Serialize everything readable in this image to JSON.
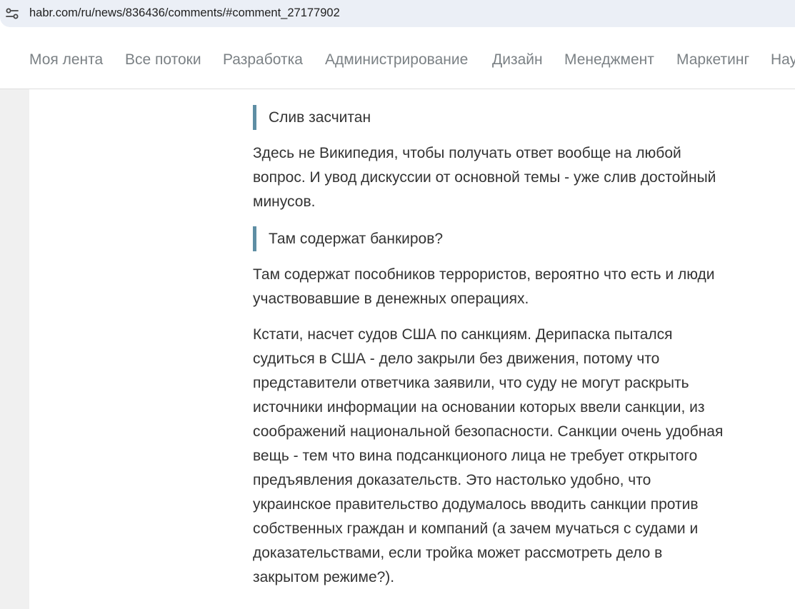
{
  "browser": {
    "url": "habr.com/ru/news/836436/comments/#comment_27177902",
    "site_info_icon": "tune-icon"
  },
  "nav": {
    "items": [
      "Моя лента",
      "Все потоки",
      "Разработка",
      "Администрирование",
      "Дизайн",
      "Менеджмент",
      "Маркетинг",
      "Нау"
    ]
  },
  "comment": {
    "quote1": "Слив засчитан",
    "para1": [
      "Здесь не Википедия, чтобы получать ответ вообще на любой",
      "вопрос. И увод дискуссии от основной темы - уже слив достойный",
      "минусов."
    ],
    "quote2": "Там содержат банкиров?",
    "para2": [
      "Там содержат пособников террористов, вероятно что есть и люди",
      "участвовавшие в денежных операциях."
    ],
    "para3": [
      "Кстати, насчет судов США по санкциям. Дерипаска пытался",
      "судиться в США - дело закрыли без движения, потому что",
      "представители ответчика заявили, что суду не могут раскрыть",
      "источники информации на основании которых ввели санкции, из",
      "соображений национальной безопасности. Санкции очень удобная",
      "вещь - тем что вина подсанкционого лица не требует открытого",
      "предъявления доказательств. Это настолько удобно, что",
      "украинское правительство додумалось вводить санкции против",
      "собственных граждан и компаний (а зачем мучаться с судами и",
      "доказательствами, если тройка может рассмотреть дело в",
      "закрытом режиме?)."
    ]
  }
}
